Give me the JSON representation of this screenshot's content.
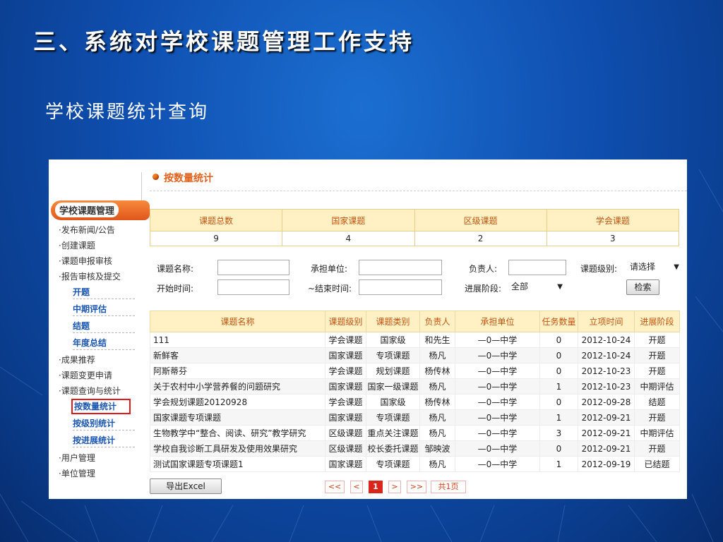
{
  "slide": {
    "title": "三、系统对学校课题管理工作支持",
    "subtitle": "学校课题统计查询"
  },
  "sidebar": {
    "header": "学校课题管理",
    "items": [
      "·发布新闻/公告",
      "·创建课题",
      "·课题申报审核",
      "·报告审核及提交"
    ],
    "report_subitems": [
      "开题",
      "中期评估",
      "结题",
      "年度总结"
    ],
    "items2": [
      "·成果推荐",
      "·课题变更申请",
      "·课题查询与统计"
    ],
    "query_subitems": [
      "按数量统计",
      "按级别统计",
      "按进展统计"
    ],
    "items3": [
      "·用户管理",
      "·单位管理"
    ]
  },
  "panel": {
    "title": "按数量统计"
  },
  "stats": {
    "headers": [
      "课题总数",
      "国家课题",
      "区级课题",
      "学会课题"
    ],
    "values": [
      "9",
      "4",
      "2",
      "3"
    ]
  },
  "filters": {
    "name_label": "课题名称:",
    "unit_label": "承担单位:",
    "owner_label": "负责人:",
    "level_label": "课题级别:",
    "level_value": "请选择",
    "start_label": "开始时间:",
    "end_label": "~结束时间:",
    "stage_label": "进展阶段:",
    "stage_value": "全部",
    "search_button": "检索"
  },
  "list": {
    "headers": [
      "课题名称",
      "课题级别",
      "课题类别",
      "负责人",
      "承担单位",
      "任务数量",
      "立项时间",
      "进展阶段"
    ],
    "rows": [
      [
        "111",
        "学会课题",
        "国家级",
        "和先生",
        "—0—中学",
        "0",
        "2012-10-24",
        "开题"
      ],
      [
        "新鲜客",
        "国家课题",
        "专项课题",
        "杨凡",
        "—0—中学",
        "0",
        "2012-10-24",
        "开题"
      ],
      [
        "阿斯蒂芬",
        "学会课题",
        "规划课题",
        "杨传林",
        "—0—中学",
        "0",
        "2012-10-23",
        "开题"
      ],
      [
        "关于农村中小学营养餐的问题研究",
        "国家课题",
        "国家一级课题",
        "杨凡",
        "—0—中学",
        "1",
        "2012-10-23",
        "中期评估"
      ],
      [
        "学会规划课题20120928",
        "学会课题",
        "国家级",
        "杨传林",
        "—0—中学",
        "0",
        "2012-09-28",
        "结题"
      ],
      [
        "国家课题专项课题",
        "国家课题",
        "专项课题",
        "杨凡",
        "—0—中学",
        "1",
        "2012-09-21",
        "开题"
      ],
      [
        "生物教学中“整合、阅读、研究”教学研究",
        "区级课题",
        "重点关注课题",
        "杨凡",
        "—0—中学",
        "3",
        "2012-09-21",
        "中期评估"
      ],
      [
        "学校自我诊断工具研发及使用效果研究",
        "区级课题",
        "校长委托课题",
        "邹映波",
        "—0—中学",
        "0",
        "2012-09-21",
        "开题"
      ],
      [
        "测试国家课题专项课题1",
        "国家课题",
        "专项课题",
        "杨凡",
        "—0—中学",
        "1",
        "2012-09-19",
        "已结题"
      ]
    ]
  },
  "footer": {
    "export_button": "导出Excel",
    "first": "<<",
    "prev": "<",
    "current_page": "1",
    "next": ">",
    "last": ">>",
    "total": "共1页"
  }
}
